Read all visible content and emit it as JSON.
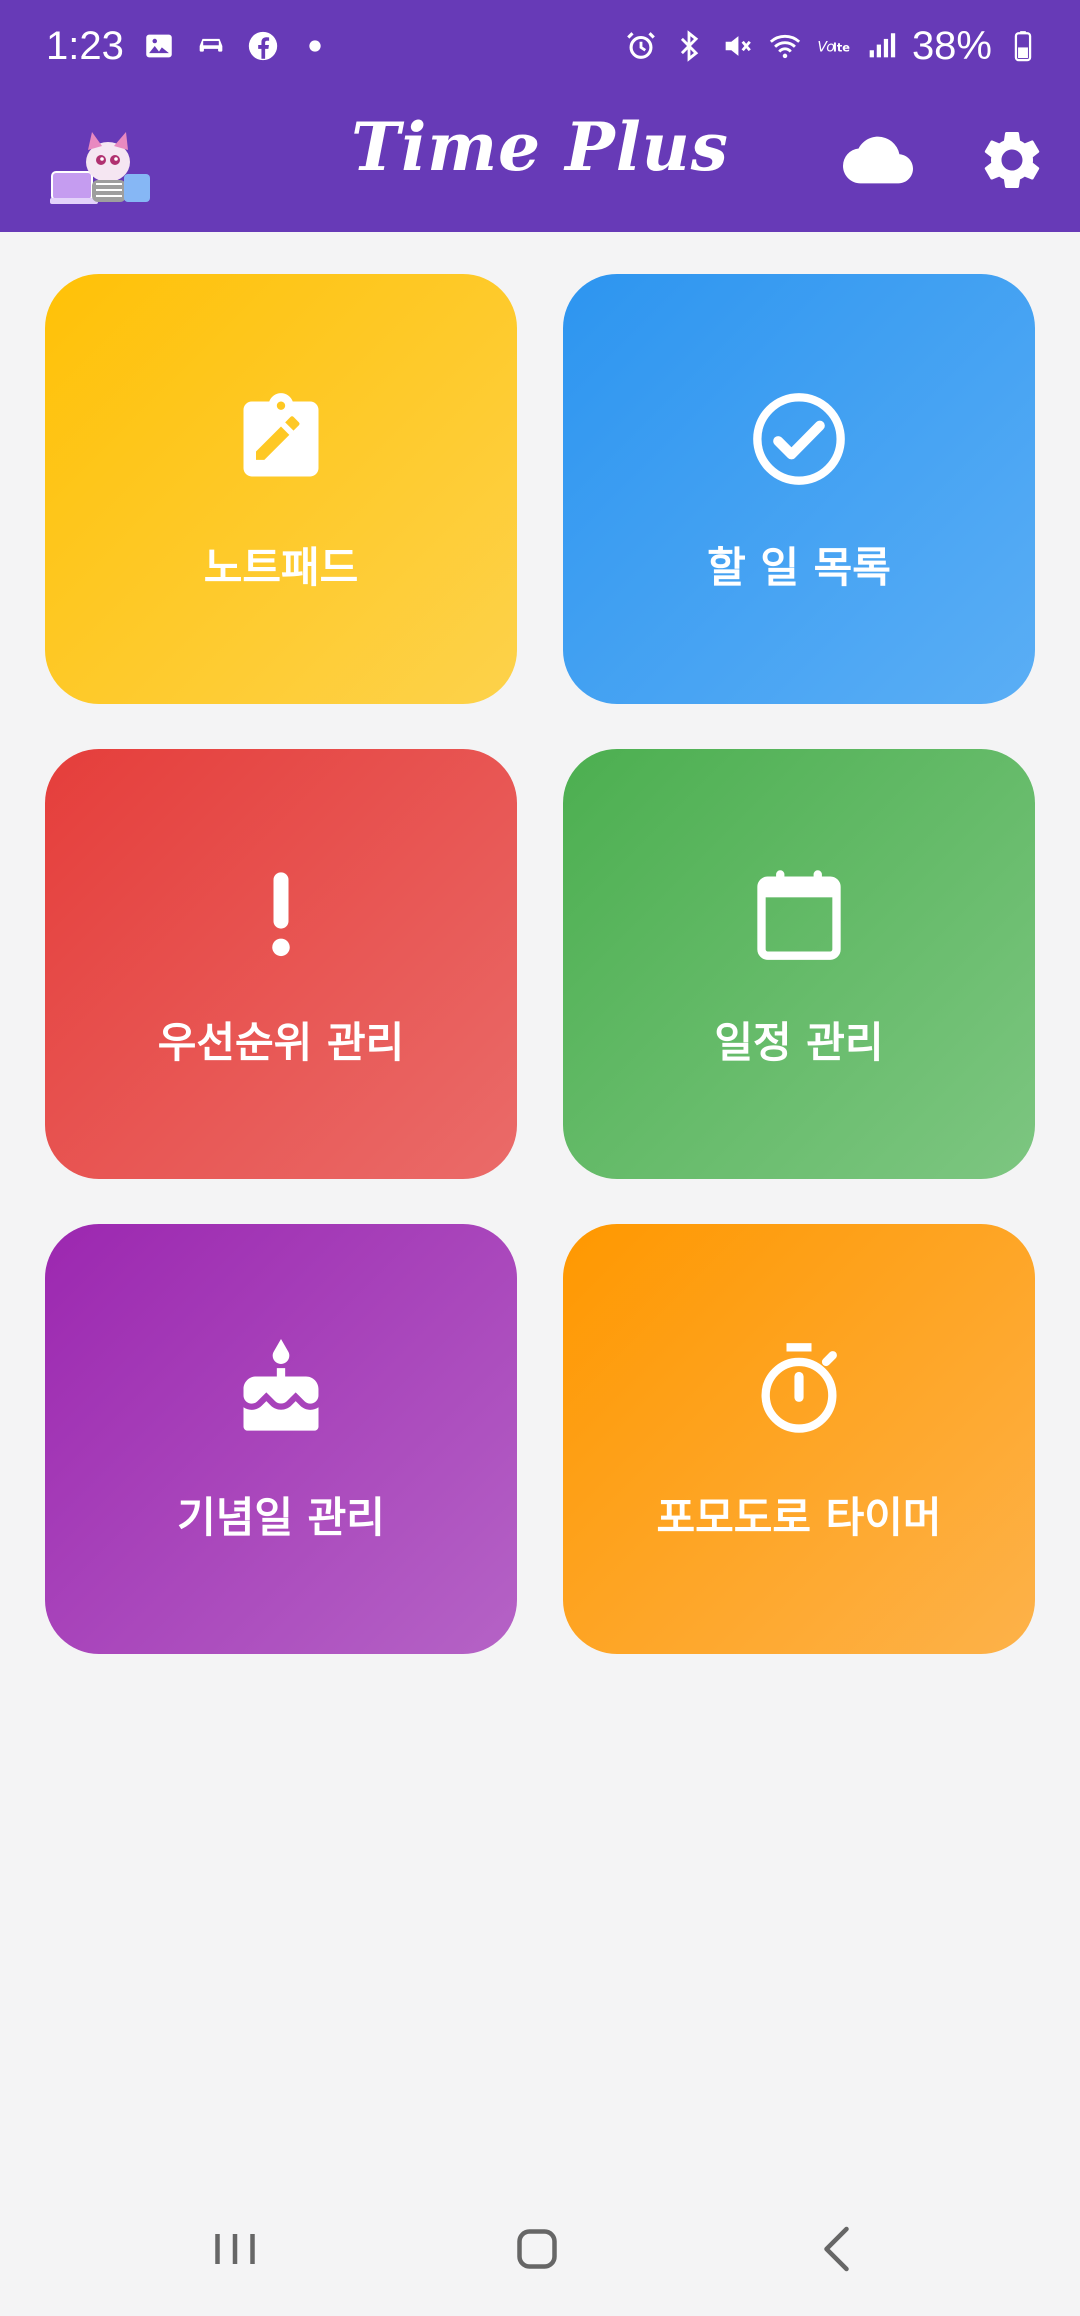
{
  "status_bar": {
    "time": "1:23",
    "battery": "38%",
    "left_icons": [
      "gallery-icon",
      "car-icon",
      "facebook-icon",
      "dot-icon"
    ],
    "right_icons": [
      "alarm-icon",
      "bluetooth-icon",
      "mute-icon",
      "wifi-icon",
      "volte-icon",
      "signal-icon",
      "battery-icon"
    ]
  },
  "app_bar": {
    "title": "Time Plus",
    "logo": "app-logo-icon",
    "actions": [
      "cloud-icon",
      "settings-icon"
    ]
  },
  "tiles": [
    {
      "label": "노트패드",
      "icon": "clipboard-edit-icon",
      "color": "#ffc107"
    },
    {
      "label": "할 일 목록",
      "icon": "check-circle-icon",
      "color": "#2196f3"
    },
    {
      "label": "우선순위 관리",
      "icon": "exclamation-icon",
      "color": "#e53935"
    },
    {
      "label": "일정 관리",
      "icon": "calendar-icon",
      "color": "#4caf50"
    },
    {
      "label": "기념일 관리",
      "icon": "cake-icon",
      "color": "#9c27b0"
    },
    {
      "label": "포모도로 타이머",
      "icon": "stopwatch-icon",
      "color": "#ff9800"
    }
  ],
  "theme": {
    "primary": "#673ab7",
    "background": "#f4f4f5"
  },
  "nav_bar": [
    "recents-icon",
    "home-icon",
    "back-icon"
  ]
}
